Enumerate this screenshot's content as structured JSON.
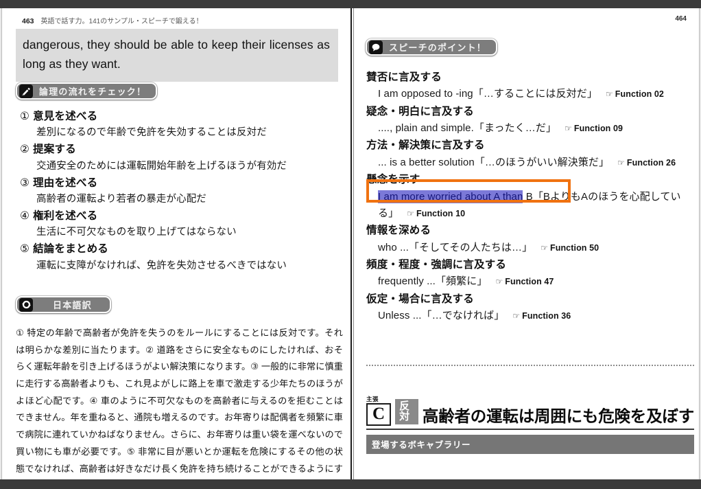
{
  "window": {
    "top_bar_color": "#3b3b3b",
    "bottom_bar_color": "#3b3b3b"
  },
  "left_page": {
    "running_head": {
      "page_number": "463",
      "title": "英語で話す力。141のサンプル・スピーチで鍛える！"
    },
    "english_passage": "dangerous, they should be able to keep their licenses as long as they want.",
    "check_badge": {
      "icon": "pencil-icon",
      "label": "論理の流れをチェック！"
    },
    "outline": [
      {
        "num": "①",
        "head": "意見を述べる",
        "body": "差別になるので年齢で免許を失効することは反対だ"
      },
      {
        "num": "②",
        "head": "提案する",
        "body": "交通安全のためには運転開始年齢を上げるほうが有効だ"
      },
      {
        "num": "③",
        "head": "理由を述べる",
        "body": "高齢者の運転より若者の暴走が心配だ"
      },
      {
        "num": "④",
        "head": "権利を述べる",
        "body": "生活に不可欠なものを取り上げてはならない"
      },
      {
        "num": "⑤",
        "head": "結論をまとめる",
        "body": "運転に支障がなければ、免許を失効させるべきではない"
      }
    ],
    "translation_badge": {
      "icon": "refresh-icon",
      "label": "日本語訳"
    },
    "translation_text": "① 特定の年齢で高齢者が免許を失うのをルールにすることには反対です。それは明らかな差別に当たります。② 道路をさらに安全なものにしたければ、おそらく運転年齢を引き上げるほうがよい解決策になります。③ 一般的に非常に慎重に走行する高齢者よりも、これ見よがしに路上を車で激走する少年たちのほうがよほど心配です。④ 車のように不可欠なものを高齢者に与えるのを拒むことはできません。年を重ねると、通院も増えるのです。お年寄りは配偶者を頻繁に車で病院に連れていかねばなりません。さらに、お年寄りは重い袋を運べないので買い物にも車が必要です。⑤ 非常に目が悪いとか運転を危険にするその他の状態でなければ、高齢者は好きなだけ長く免許を持ち続けることができるようにすべきなのです。"
  },
  "right_page": {
    "running_head": {
      "page_number": "464"
    },
    "point_badge": {
      "icon": "speech-bubble-icon",
      "label": "スピーチのポイント！"
    },
    "hand_icon": "☞",
    "points": [
      {
        "head": "賛否に言及する",
        "expression": "I am opposed to -ing",
        "gloss": "「…することには反対だ」",
        "function": "Function 02",
        "selected": false
      },
      {
        "head": "疑念・明白に言及する",
        "expression": "...., plain and simple.",
        "gloss": "「まったく…だ」",
        "function": "Function 09",
        "selected": false
      },
      {
        "head": "方法・解決策に言及する",
        "expression": "... is a better solution",
        "gloss": "「…のほうがいい解決策だ」",
        "function": "Function 26",
        "selected": false
      },
      {
        "head": "懸念を示す",
        "expression_selected": "I am more worried about A than",
        "expression_tail": " B",
        "gloss": "「BよりもAのほうを心配している」",
        "function": "Function 10",
        "selected": true,
        "highlight_border_color": "#f07210",
        "selection_bg_color": "#7b79d8",
        "selection_text_color": "#16167a"
      },
      {
        "head": "情報を深める",
        "expression": "who ...",
        "gloss": "「そしてその人たちは…」",
        "function": "Function 50",
        "selected": false
      },
      {
        "head": "頻度・程度・強調に言及する",
        "expression": "frequently ...",
        "gloss": "「頻繁に」",
        "function": "Function 47",
        "selected": false
      },
      {
        "head": "仮定・場合に言及する",
        "expression": "Unless ...",
        "gloss": "「…でなければ」",
        "function": "Function 36",
        "selected": false
      }
    ],
    "claim": {
      "kicker": "主張",
      "letter": "C",
      "tag": "反対",
      "title": "高齢者の運転は周囲にも危険を及ぼす"
    },
    "vocab_bar_label": "登場するボキャブラリー"
  }
}
